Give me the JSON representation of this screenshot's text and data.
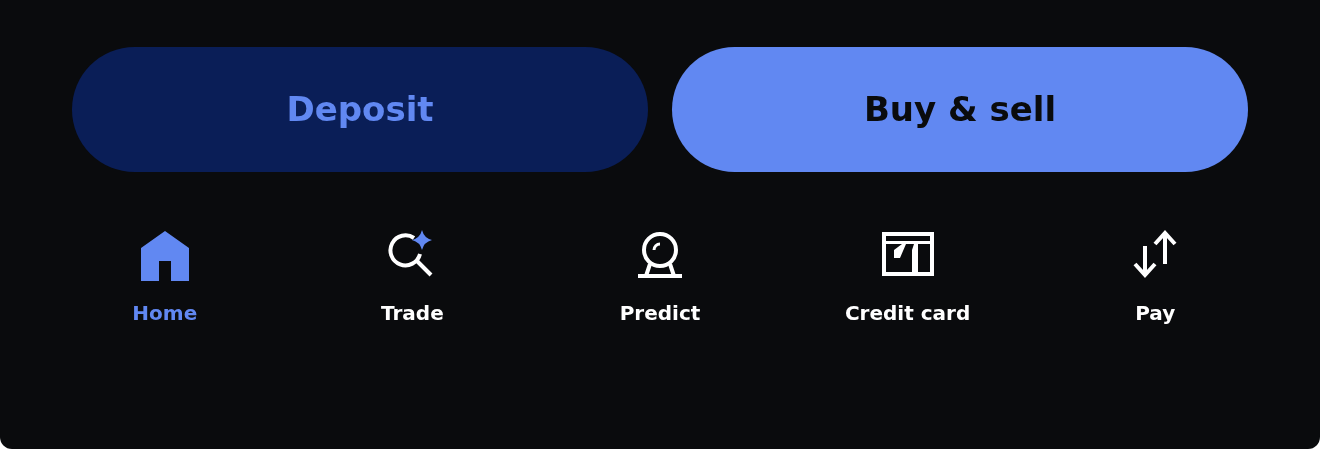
{
  "actions": [
    {
      "label": "Deposit",
      "kind": "secondary"
    },
    {
      "label": "Buy & sell",
      "kind": "primary"
    }
  ],
  "nav": [
    {
      "label": "Home",
      "selected": true
    },
    {
      "label": "Trade",
      "selected": false
    },
    {
      "label": "Predict",
      "selected": false
    },
    {
      "label": "Credit card",
      "selected": false
    },
    {
      "label": "Pay",
      "selected": false
    }
  ]
}
